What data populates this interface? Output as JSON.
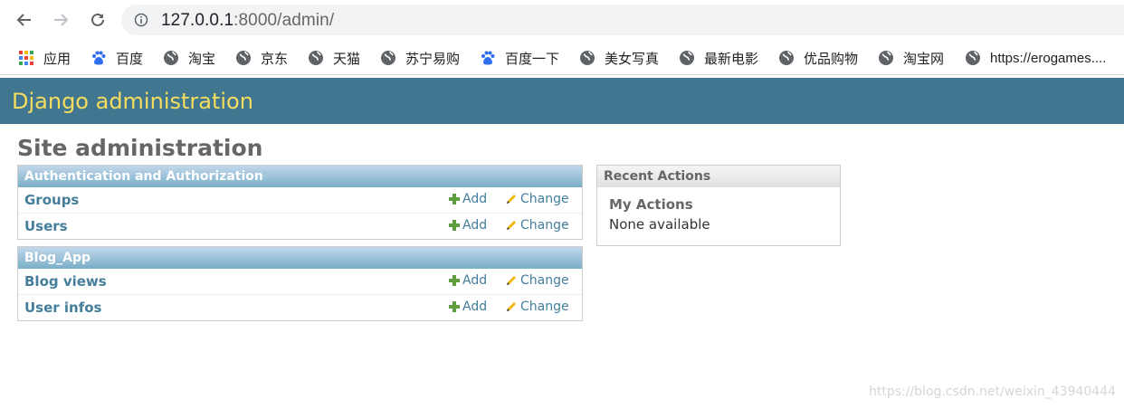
{
  "browser": {
    "url_host": "127.0.0.1",
    "url_path": ":8000/admin/",
    "bookmarks": [
      {
        "label": "应用",
        "icon": "apps-grid-icon"
      },
      {
        "label": "百度",
        "icon": "baidu-paw-icon"
      },
      {
        "label": "淘宝",
        "icon": "globe-icon"
      },
      {
        "label": "京东",
        "icon": "globe-icon"
      },
      {
        "label": "天猫",
        "icon": "globe-icon"
      },
      {
        "label": "苏宁易购",
        "icon": "globe-icon"
      },
      {
        "label": "百度一下",
        "icon": "baidu-paw-icon"
      },
      {
        "label": "美女写真",
        "icon": "globe-icon"
      },
      {
        "label": "最新电影",
        "icon": "globe-icon"
      },
      {
        "label": "优品购物",
        "icon": "globe-icon"
      },
      {
        "label": "淘宝网",
        "icon": "globe-icon"
      },
      {
        "label": "https://erogames....",
        "icon": "globe-icon"
      }
    ]
  },
  "header": {
    "site_name": "Django administration"
  },
  "page": {
    "title": "Site administration"
  },
  "modules": [
    {
      "caption": "Authentication and Authorization",
      "models": [
        {
          "name": "Groups",
          "add": "Add",
          "change": "Change"
        },
        {
          "name": "Users",
          "add": "Add",
          "change": "Change"
        }
      ]
    },
    {
      "caption": "Blog_App",
      "models": [
        {
          "name": "Blog views",
          "add": "Add",
          "change": "Change"
        },
        {
          "name": "User infos",
          "add": "Add",
          "change": "Change"
        }
      ]
    }
  ],
  "recent_actions": {
    "caption": "Recent Actions",
    "subtitle": "My Actions",
    "empty": "None available"
  },
  "watermark": "https://blog.csdn.net/weixin_43940444",
  "colors": {
    "header_bg": "#417690",
    "header_text": "#f5dd5d",
    "link": "#447e9b",
    "caption_bg": "#79aec8"
  }
}
